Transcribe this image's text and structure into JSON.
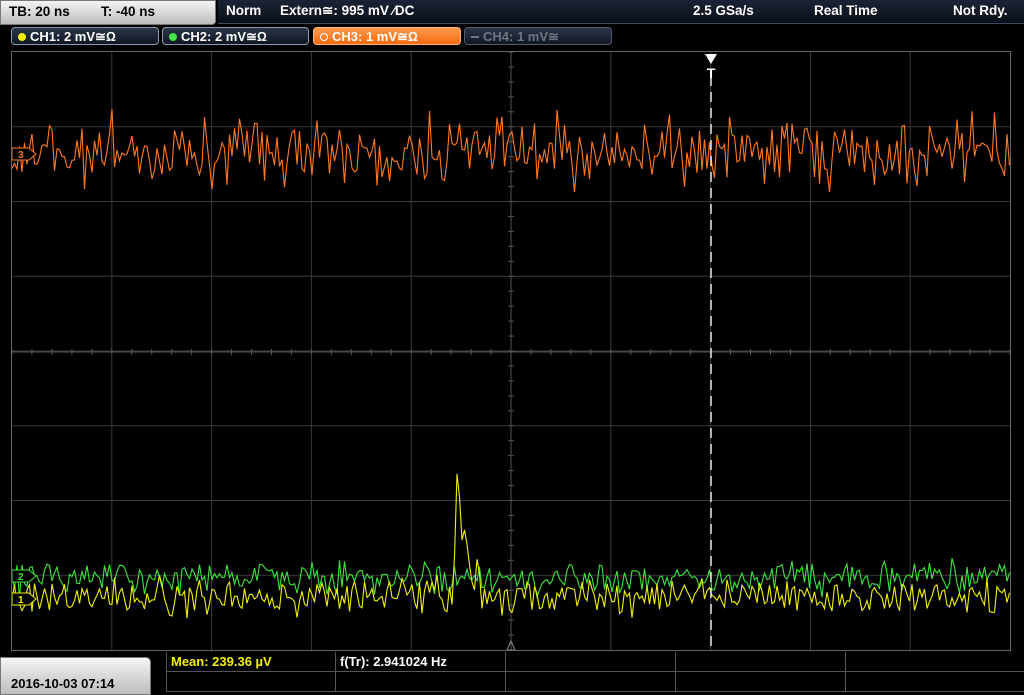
{
  "status": {
    "timebase": "TB: 20 ns",
    "trigger_time": "T: -40 ns",
    "mode": "Norm",
    "trigger_source": "Extern≅: 995 mV ∕DC",
    "sample_rate": "2.5 GSa/s",
    "acquisition": "Real Time",
    "ready_state": "Not Rdy."
  },
  "channels": [
    {
      "label": "CH1: 2 mV≅Ω",
      "color": "#f2f200"
    },
    {
      "label": "CH2: 2 mV≅Ω",
      "color": "#3ee53e"
    },
    {
      "label": "CH3: 1 mV≅Ω",
      "color": "#ff7a1f"
    },
    {
      "label": "CH4: 1 mV≅",
      "color": "#6f7480"
    }
  ],
  "markers": {
    "ch3": "3",
    "ch2": "2",
    "ch1": "1",
    "trigger": "T"
  },
  "measurements": {
    "mean": "Mean: 239.36 µV",
    "freq": "f(Tr): 2.941024 Hz"
  },
  "datetime": "2016-10-03  07:14",
  "colors": {
    "ch1": "#f2f200",
    "ch2": "#3ee53e",
    "ch3": "#ff7a1f",
    "grid": "#3a3a3a"
  }
}
